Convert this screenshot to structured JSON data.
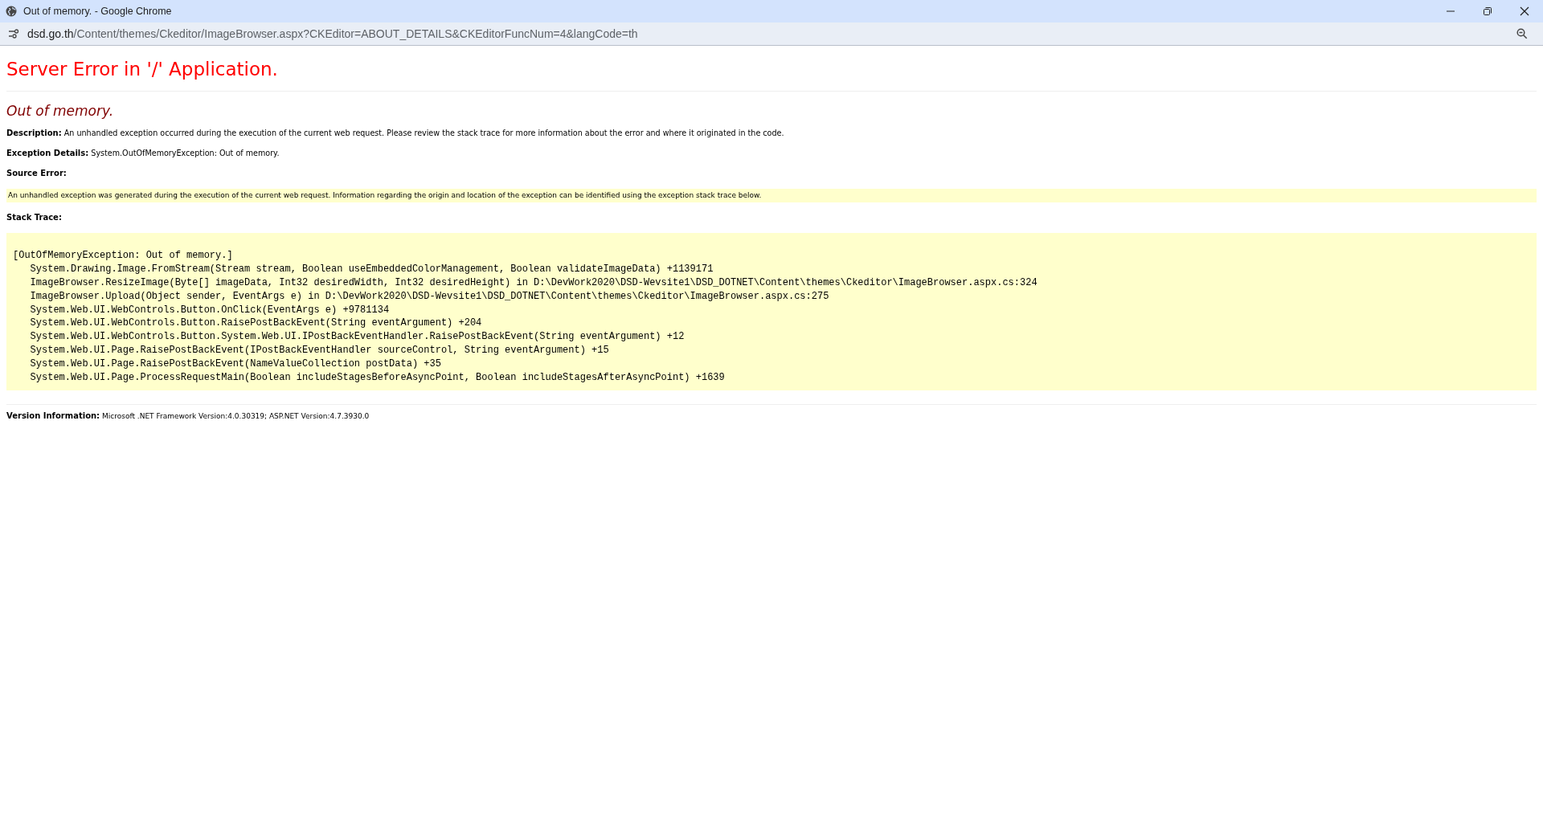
{
  "window": {
    "title": "Out of memory. - Google Chrome"
  },
  "address_bar": {
    "host": "dsd.go.th",
    "path": "/Content/themes/Ckeditor/ImageBrowser.aspx?CKEditor=ABOUT_DETAILS&CKEditorFuncNum=4&langCode=th"
  },
  "page": {
    "heading": "Server Error in '/' Application.",
    "error_title": "Out of memory.",
    "description": {
      "label": "Description:",
      "text": "An unhandled exception occurred during the execution of the current web request. Please review the stack trace for more information about the error and where it originated in the code."
    },
    "exception_details": {
      "label": "Exception Details:",
      "text": "System.OutOfMemoryException: Out of memory."
    },
    "source_error": {
      "label": "Source Error:",
      "text": "An unhandled exception was generated during the execution of the current web request. Information regarding the origin and location of the exception can be identified using the exception stack trace below."
    },
    "stack_trace": {
      "label": "Stack Trace:",
      "lines": [
        "[OutOfMemoryException: Out of memory.]",
        "   System.Drawing.Image.FromStream(Stream stream, Boolean useEmbeddedColorManagement, Boolean validateImageData) +1139171",
        "   ImageBrowser.ResizeImage(Byte[] imageData, Int32 desiredWidth, Int32 desiredHeight) in D:\\DevWork2020\\DSD-Wevsite1\\DSD_DOTNET\\Content\\themes\\Ckeditor\\ImageBrowser.aspx.cs:324",
        "   ImageBrowser.Upload(Object sender, EventArgs e) in D:\\DevWork2020\\DSD-Wevsite1\\DSD_DOTNET\\Content\\themes\\Ckeditor\\ImageBrowser.aspx.cs:275",
        "   System.Web.UI.WebControls.Button.OnClick(EventArgs e) +9781134",
        "   System.Web.UI.WebControls.Button.RaisePostBackEvent(String eventArgument) +204",
        "   System.Web.UI.WebControls.Button.System.Web.UI.IPostBackEventHandler.RaisePostBackEvent(String eventArgument) +12",
        "   System.Web.UI.Page.RaisePostBackEvent(IPostBackEventHandler sourceControl, String eventArgument) +15",
        "   System.Web.UI.Page.RaisePostBackEvent(NameValueCollection postData) +35",
        "   System.Web.UI.Page.ProcessRequestMain(Boolean includeStagesBeforeAsyncPoint, Boolean includeStagesAfterAsyncPoint) +1639"
      ]
    },
    "version_information": {
      "label": "Version Information:",
      "text": "Microsoft .NET Framework Version:4.0.30319; ASP.NET Version:4.7.3930.0"
    }
  }
}
